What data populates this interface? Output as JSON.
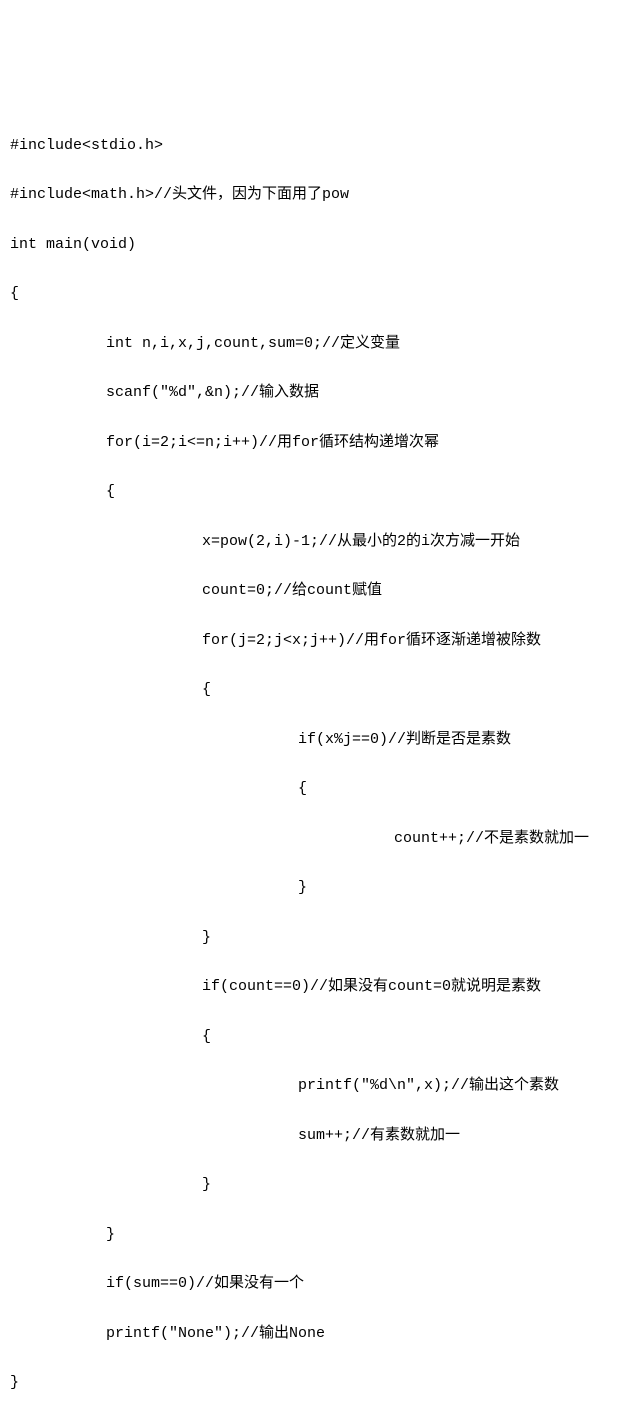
{
  "code": {
    "l1": "#include<stdio.h>",
    "l2": "#include<math.h>//头文件，因为下面用了pow",
    "l3": "int main(void)",
    "l4": "{",
    "l5": "int n,i,x,j,count,sum=0;//定义变量",
    "l6": "scanf(\"%d\",&n);//输入数据",
    "l7": "for(i=2;i<=n;i++)//用for循环结构递增次幂",
    "l8": "{",
    "l9": "x=pow(2,i)-1;//从最小的2的i次方减一开始",
    "l10": "count=0;//给count赋值",
    "l11": "for(j=2;j<x;j++)//用for循环逐渐递增被除数",
    "l12": "{",
    "l13": "if(x%j==0)//判断是否是素数",
    "l14": "{",
    "l15": "count++;//不是素数就加一",
    "l16": "}",
    "l17": "}",
    "l18": "if(count==0)//如果没有count=0就说明是素数",
    "l19": "{",
    "l20": "printf(\"%d\\n\",x);//输出这个素数",
    "l21": "sum++;//有素数就加一",
    "l22": "}",
    "l23": "}",
    "l24": "if(sum==0)//如果没有一个",
    "l25": "printf(\"None\");//输出None",
    "l26": "}"
  }
}
